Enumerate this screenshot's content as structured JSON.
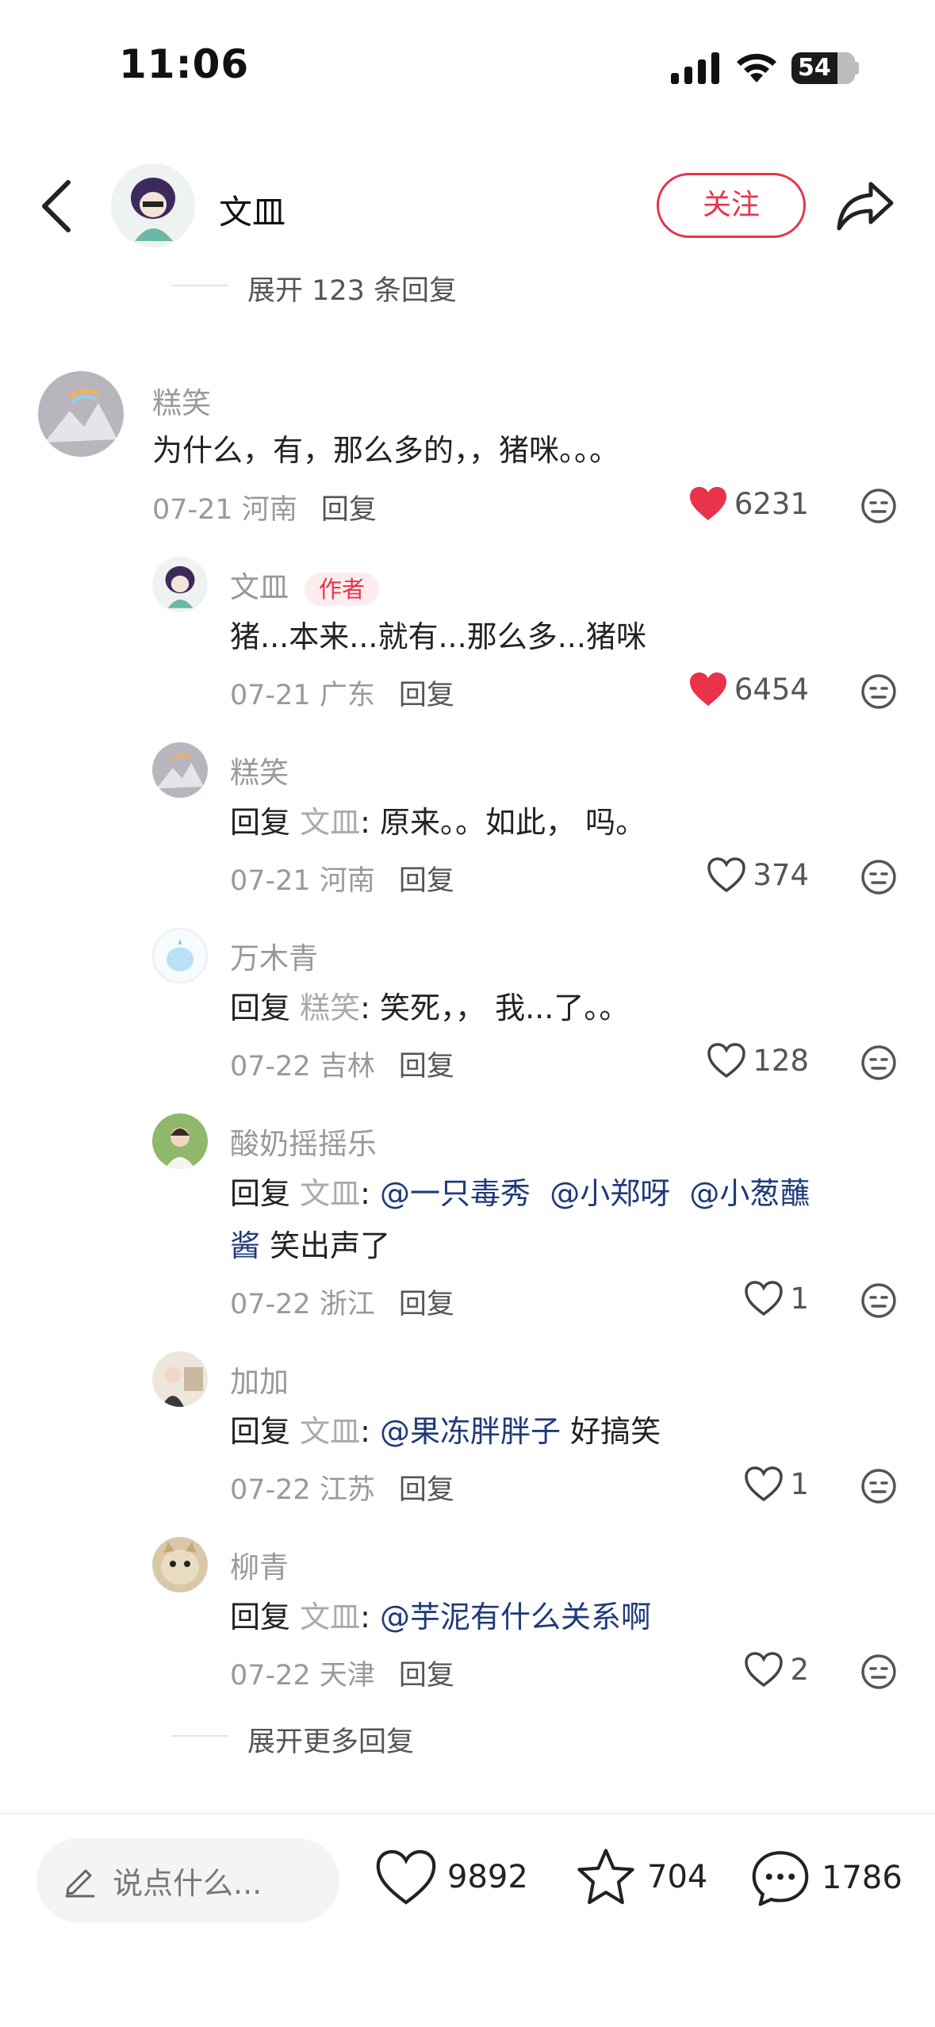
{
  "status": {
    "time": "11:06",
    "battery": "54"
  },
  "header": {
    "author": "文皿",
    "follow_label": "关注"
  },
  "thread": {
    "expand_top": "展开 123 条回复",
    "expand_more": "展开更多回复"
  },
  "comment": {
    "user": "糕笑",
    "text": "为什么，有，那么多的，，猪咪。。。",
    "date": "07-21 河南",
    "reply_label": "回复",
    "likes": "6231",
    "liked": true
  },
  "replies": [
    {
      "user": "文皿",
      "tag": "作者",
      "text": "猪...本来...就有...那么多...猪咪",
      "date": "07-21 广东",
      "likes": "6454",
      "liked": true
    },
    {
      "user": "糕笑",
      "reply_word": "回复",
      "reply_to": "文皿",
      "sep": ":",
      "text": " 原来。。如此， 吗。",
      "date": "07-21 河南",
      "likes": "374"
    },
    {
      "user": "万木青",
      "reply_word": "回复",
      "reply_to": "糕笑",
      "sep": ":",
      "text": " 笑死，， 我...了。。",
      "date": "07-22 吉林",
      "likes": "128"
    },
    {
      "user": "酸奶摇摇乐",
      "reply_word": "回复",
      "reply_to": "文皿",
      "sep": ":",
      "m1": " @一只毒秀",
      "m2": " @小郑呀",
      "m3": " @小葱蘸",
      "m3b": "酱",
      "tail": " 笑出声了",
      "date": "07-22 浙江",
      "likes": "1"
    },
    {
      "user": "加加",
      "reply_word": "回复",
      "reply_to": "文皿",
      "sep": ":",
      "m1": " @果冻胖胖子",
      "tail": " 好搞笑",
      "date": "07-22 江苏",
      "likes": "1"
    },
    {
      "user": "柳青",
      "reply_word": "回复",
      "reply_to": "文皿",
      "sep": ":",
      "m1": " @芋泥有什么关系啊",
      "date": "07-22 天津",
      "likes": "2"
    }
  ],
  "reply_label": "回复",
  "bottom": {
    "placeholder": "说点什么...",
    "likes": "9892",
    "stars": "704",
    "comments": "1786"
  },
  "colors": {
    "accent": "#e8334b",
    "mention": "#1f3a7a",
    "liked_heart": "#e8334b"
  },
  "icons": [
    "back-icon",
    "share-icon",
    "heart-icon",
    "dislike-face-icon",
    "pencil-icon",
    "star-icon",
    "comment-bubble-icon",
    "signal-icon",
    "wifi-icon",
    "battery-icon"
  ]
}
